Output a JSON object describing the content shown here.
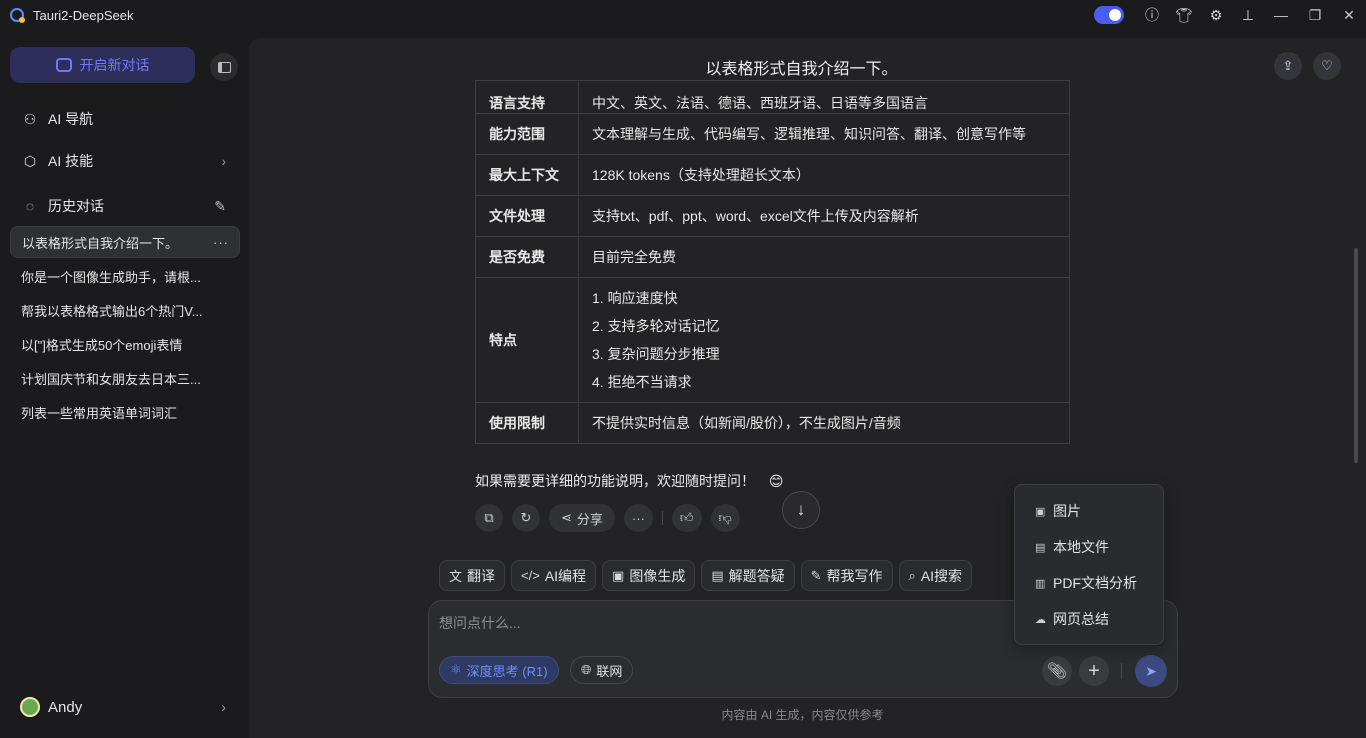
{
  "app": {
    "title": "Tauri2-DeepSeek"
  },
  "sidebar": {
    "new_chat": "开启新对话",
    "nav": [
      {
        "label": "AI 导航",
        "icon": "compass-icon"
      },
      {
        "label": "AI 技能",
        "icon": "cube-icon"
      },
      {
        "label": "历史对话",
        "icon": "chat-icon"
      }
    ],
    "history": [
      "以表格形式自我介绍一下。",
      "你是一个图像生成助手，请根...",
      "帮我以表格格式输出6个热门V...",
      "以[\"]格式生成50个emoji表情",
      "计划国庆节和女朋友去日本三...",
      "列表一些常用英语单词词汇"
    ],
    "user": {
      "name": "Andy"
    }
  },
  "chat": {
    "title": "以表格形式自我介绍一下。",
    "table": [
      {
        "key": "语言支持",
        "value": "中文、英文、法语、德语、西班牙语、日语等多国语言"
      },
      {
        "key": "能力范围",
        "value": "文本理解与生成、代码编写、逻辑推理、知识问答、翻译、创意写作等"
      },
      {
        "key": "最大上下文",
        "value": "128K tokens（支持处理超长文本）"
      },
      {
        "key": "文件处理",
        "value": "支持txt、pdf、ppt、word、excel文件上传及内容解析"
      },
      {
        "key": "是否免费",
        "value": "目前完全免费"
      },
      {
        "key": "特点",
        "lines": [
          "1. 响应速度快",
          "2. 支持多轮对话记忆",
          "3. 复杂问题分步推理",
          "4. 拒绝不当请求"
        ]
      },
      {
        "key": "使用限制",
        "value": "不提供实时信息（如新闻/股价），不生成图片/音频"
      }
    ],
    "tail": "如果需要更详细的功能说明，欢迎随时提问！",
    "tail_emoji": "😊",
    "actions": {
      "share": "分享"
    }
  },
  "skills": [
    "翻译",
    "AI编程",
    "图像生成",
    "解题答疑",
    "帮我写作",
    "AI搜索"
  ],
  "composer": {
    "placeholder": "想问点什么...",
    "deep_think": "深度思考 (R1)",
    "web": "联网"
  },
  "upload_menu": [
    "图片",
    "本地文件",
    "PDF文档分析",
    "网页总结"
  ],
  "footer": "内容由 AI 生成，内容仅供参考",
  "colors": {
    "accent": "#6f78ff",
    "toggle": "#4b5cf0",
    "bg": "#1b1b1d",
    "panel": "#232325"
  }
}
